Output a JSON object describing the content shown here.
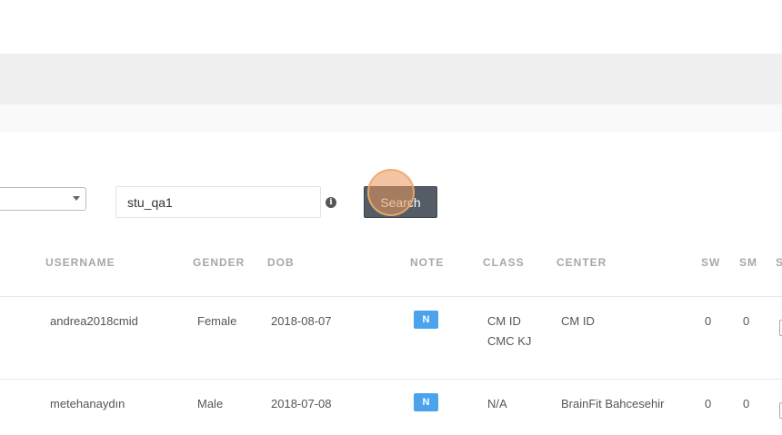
{
  "search": {
    "value": "stu_qa1",
    "button_label": "Search"
  },
  "table": {
    "headers": {
      "username": "USERNAME",
      "gender": "GENDER",
      "dob": "DOB",
      "note": "NOTE",
      "class": "CLASS",
      "center": "CENTER",
      "sw": "SW",
      "sm": "SM",
      "s": "S"
    },
    "rows": [
      {
        "username": "andrea2018cmid",
        "gender": "Female",
        "dob": "2018-08-07",
        "note": "N",
        "class": [
          "CM ID",
          "CMC KJ"
        ],
        "center": "CM ID",
        "sw": "0",
        "sm": "0"
      },
      {
        "username": "metehanaydın",
        "gender": "Male",
        "dob": "2018-07-08",
        "note": "N",
        "class": [
          "N/A"
        ],
        "center": "BrainFit Bahcesehir",
        "sw": "0",
        "sm": "0"
      }
    ]
  }
}
